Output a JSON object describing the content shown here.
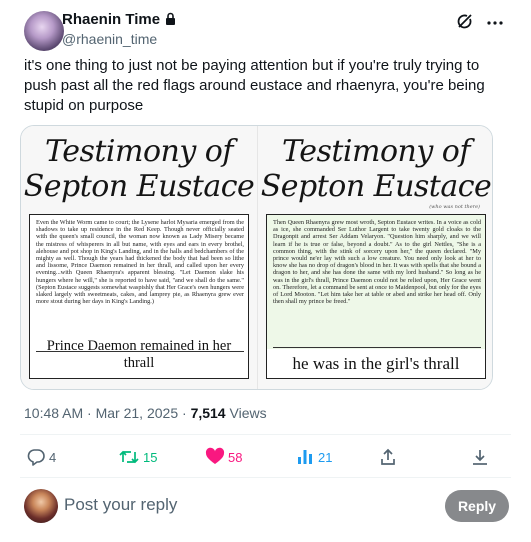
{
  "author": {
    "name": "Rhaenin Time",
    "handle": "@rhaenin_time"
  },
  "tweet": {
    "text": "it's one thing to just not be paying attention but if you're truly trying to push past all the red flags around eustace and rhaenyra, you're being stupid on purpose"
  },
  "media": {
    "left": {
      "title_line1": "Testimony of",
      "title_line2": "Septon Eustace",
      "body": "Even the White Worm came to court; the Lysene harlot Mysaria emerged from the shadows to take up residence in the Red Keep. Though never officially seated with the queen's small council, the woman now known as Lady Misery became the mistress of whisperers in all but name, with eyes and ears in every brothel, alehouse and pot shop in King's Landing, and in the halls and bedchambers of the mighty as well. Though the years had thickened the body that had been so lithe and lissome, Prince Daemon remained in her thrall, and called upon her every evening...with Queen Rhaenyra's apparent blessing. \"Let Daemon slake his hungers where he will,\" she is reported to have said, \"and we shall do the same.\" (Septon Eustace suggests somewhat waspishly that Her Grace's own hungers were slaked largely with sweetmeats, cakes, and lamprey pie, as Rhaenyra grew ever more stout during her days in King's Landing.)",
      "caption": "Prince Daemon remained in her thrall"
    },
    "right": {
      "title_line1": "Testimony of",
      "title_line2": "Septon Eustace",
      "subnote": "(who was not there)",
      "body": "Then Queen Rhaenyra grew most wroth, Septon Eustace writes. In a voice as cold as ice, she commanded Ser Luthor Largent to take twenty gold cloaks to the Dragonpit and arrest Ser Addam Velaryon. \"Question him sharply, and we will learn if he is true or false, beyond a doubt.\" As to the girl Nettles, \"She is a common thing, with the stink of sorcery upon her,\" the queen declared. \"My prince would ne'er lay with such a low creature. You need only look at her to know she has no drop of dragon's blood in her. It was with spells that she bound a dragon to her, and she has done the same with my lord husband.\" So long as he was in the girl's thrall, Prince Daemon could not be relied upon, Her Grace went on. Therefore, let a command be sent at once to Maidenpool, but only for the eyes of Lord Mooton. \"Let him take her at table or abed and strike her head off. Only then shall my prince be freed.\"",
      "caption": "he was in the girl's thrall"
    }
  },
  "meta": {
    "time": "10:48 AM",
    "sep": "·",
    "date": "Mar 21, 2025",
    "views_count": "7,514",
    "views_label": "Views"
  },
  "actions": {
    "replies": "4",
    "retweets": "15",
    "likes": "58",
    "views": "21"
  },
  "compose": {
    "placeholder": "Post your reply",
    "button": "Reply"
  },
  "colors": {
    "retweet": "#00ba7c",
    "like": "#f91880",
    "views": "#1d9bf0",
    "reply_button": "#87898c"
  },
  "icons": [
    "lock-icon",
    "grok-icon",
    "more-icon",
    "reply-icon",
    "retweet-icon",
    "heart-icon",
    "views-icon",
    "share-icon",
    "bookmark-icon"
  ]
}
